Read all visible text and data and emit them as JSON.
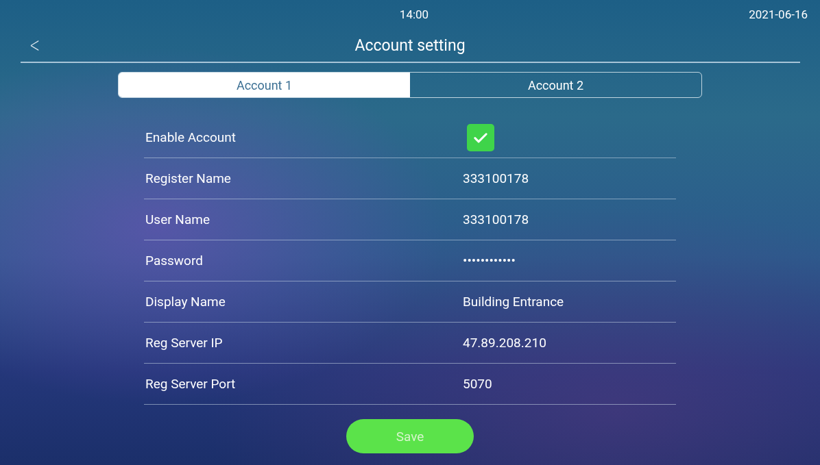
{
  "status_bar": {
    "time": "14:00",
    "date": "2021-06-16"
  },
  "header": {
    "back": "<",
    "title": "Account setting"
  },
  "tabs": [
    {
      "label": "Account 1",
      "selected": true
    },
    {
      "label": "Account 2",
      "selected": false
    }
  ],
  "rows": [
    {
      "kind": "checkbox",
      "label": "Enable Account",
      "checked": true
    },
    {
      "kind": "text",
      "label": "Register Name",
      "value": "333100178"
    },
    {
      "kind": "text",
      "label": "User Name",
      "value": "333100178"
    },
    {
      "kind": "text",
      "label": "Password",
      "value": "••••••••••••"
    },
    {
      "kind": "text",
      "label": "Display Name",
      "value": "Building Entrance"
    },
    {
      "kind": "text",
      "label": "Reg Server IP",
      "value": "47.89.208.210"
    },
    {
      "kind": "text",
      "label": "Reg Server Port",
      "value": "5070"
    }
  ],
  "save_button": "Save"
}
